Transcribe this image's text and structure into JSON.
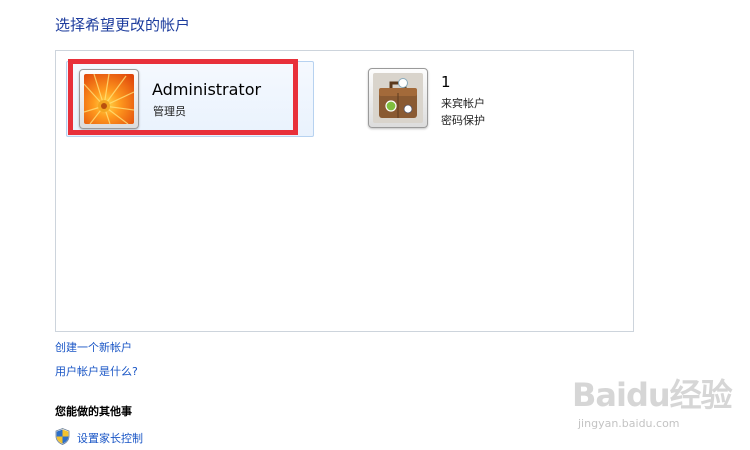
{
  "page": {
    "title": "选择希望更改的帐户"
  },
  "accounts": [
    {
      "name": "Administrator",
      "type": "管理员"
    },
    {
      "name": "1",
      "type": "来宾帐户",
      "password_status": "密码保护"
    }
  ],
  "links": {
    "create_account": "创建一个新帐户",
    "what_is_account": "用户帐户是什么?"
  },
  "other_tasks": {
    "heading": "您能做的其他事",
    "items": [
      {
        "label": "设置家长控制",
        "icon": "uac-shield-icon"
      }
    ]
  },
  "watermark": {
    "logo": "Baidu经验",
    "url": "jingyan.baidu.com"
  },
  "colors": {
    "link": "#1a56c6",
    "title": "#1e3d9e",
    "highlight": "#e8303a"
  }
}
